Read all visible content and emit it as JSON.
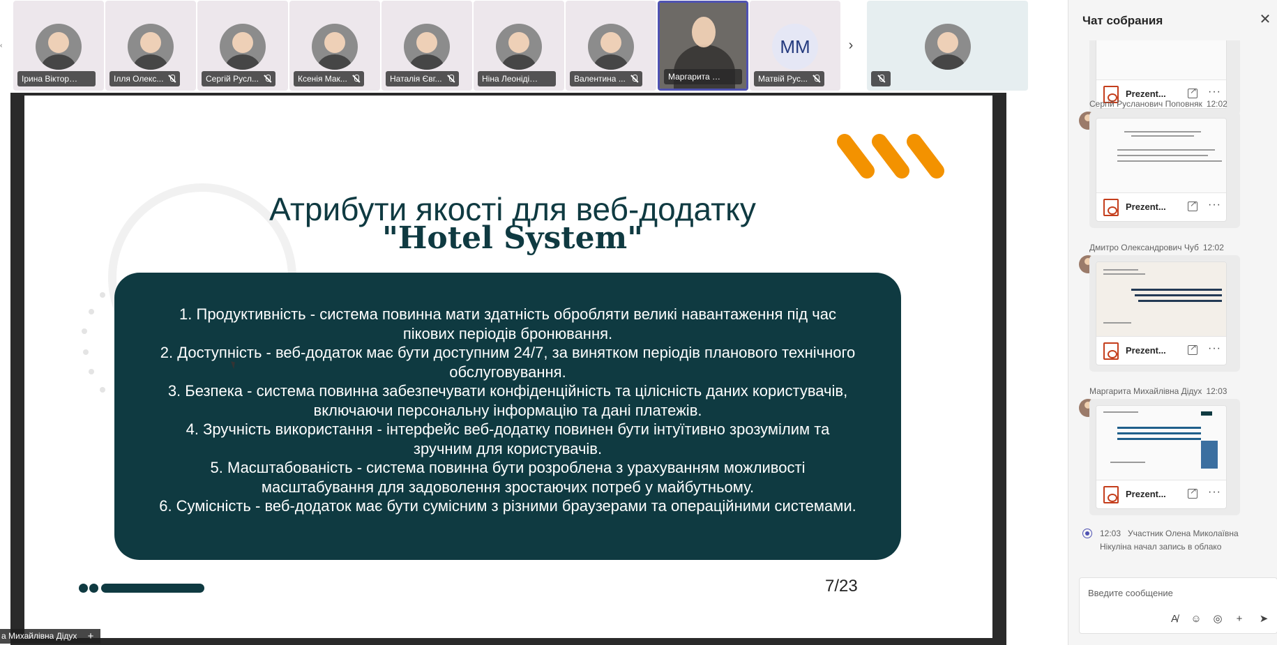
{
  "participants": [
    {
      "name": "Ірина Вікторівн...",
      "muted": false
    },
    {
      "name": "Ілля Олекс...",
      "muted": true
    },
    {
      "name": "Сергій Русл...",
      "muted": true
    },
    {
      "name": "Ксенія Мак...",
      "muted": true
    },
    {
      "name": "Наталія Євг...",
      "muted": true
    },
    {
      "name": "Ніна Леонідівн...",
      "muted": false
    },
    {
      "name": "Валентина ...",
      "muted": true
    },
    {
      "name": "Маргарита Мих...",
      "muted": false
    },
    {
      "name": "Матвій Рус...",
      "muted": true,
      "initials": "ММ"
    }
  ],
  "slide": {
    "title": "Атрибути якості для веб-додатку",
    "subtitle": "\"Hotel System\"",
    "items": [
      "1. Продуктивність - система повинна мати здатність обробляти великі навантаження під час пікових періодів бронювання.",
      "2. Доступність - веб-додаток має бути доступним 24/7, за винятком періодів планового технічного обслуговування.",
      "3. Безпека - система повинна забезпечувати конфіденційність та цілісність даних користувачів, включаючи персональну інформацію та дані платежів.",
      "4. Зручність використання - інтерфейс веб-додатку повинен бути інтуїтивно зрозумілим та зручним для користувачів.",
      "5. Масштабованість - система повинна бути розроблена з урахуванням можливості масштабування для задоволення зростаючих потреб у майбутньому.",
      "6. Сумісність - веб-додаток має бути сумісним з різними браузерами та операційними системами."
    ],
    "page": "7/23",
    "accent": "#0f3a41",
    "logo_color": "#f39200"
  },
  "presenter": {
    "name": "а Михайлівна Дідух"
  },
  "chat": {
    "title": "Чат собрания",
    "messages": [
      {
        "author": "",
        "time": "",
        "file": "Prezent..."
      },
      {
        "author": "Сергій Русланович Поповняк",
        "time": "12:02",
        "file": "Prezent..."
      },
      {
        "author": "Дмитро Олександрович Чуб",
        "time": "12:02",
        "file": "Prezent..."
      },
      {
        "author": "Маргарита Михайлівна Дідух",
        "time": "12:03",
        "file": "Prezent..."
      }
    ],
    "system": {
      "time": "12:03",
      "text": "Участник Олена Миколаївна Нікуліна начал запись в облако"
    },
    "composer_placeholder": "Введите сообщение"
  }
}
